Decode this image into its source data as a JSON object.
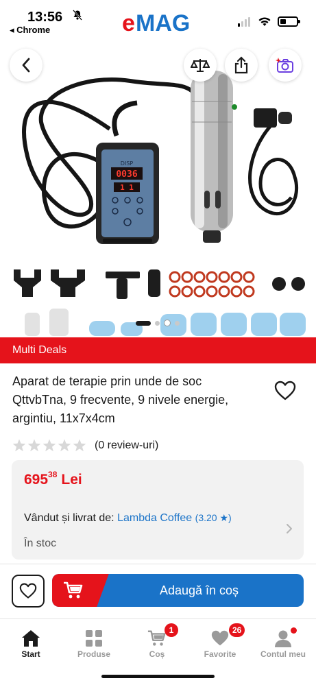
{
  "status_bar": {
    "time": "13:56",
    "back_app": "◂ Chrome",
    "brand_logo": "eMAG"
  },
  "banner": {
    "label": "Multi Deals"
  },
  "product": {
    "title": "Aparat de terapie prin unde de soc QttvbTna, 9 frecvente, 9 nivele energie, argintiu, 11x7x4cm",
    "rating_stars": 0,
    "reviews_label": "(0 review-uri)",
    "price_int": "695",
    "price_dec": "38",
    "currency": "Lei",
    "sold_by_label": "Vândut și livrat de:",
    "seller_name": "Lambda Coffee",
    "seller_score": "(3.20 ★)",
    "stock": "În stoc",
    "image_display": {
      "device_label": "DISP",
      "digits_top": "0036",
      "digits_bottom": "1 1"
    }
  },
  "actions": {
    "add_to_cart": "Adaugă în coș"
  },
  "tabs": [
    {
      "label": "Start",
      "icon": "home-icon",
      "active": true
    },
    {
      "label": "Produse",
      "icon": "grid-icon",
      "active": false
    },
    {
      "label": "Coș",
      "icon": "cart-icon",
      "badge": "1"
    },
    {
      "label": "Favorite",
      "icon": "heart-icon",
      "badge": "26"
    },
    {
      "label": "Contul meu",
      "icon": "user-icon",
      "dot": true
    }
  ],
  "colors": {
    "brand_red": "#e5131b",
    "brand_blue": "#1a73c8",
    "text": "#1b1b1b"
  }
}
